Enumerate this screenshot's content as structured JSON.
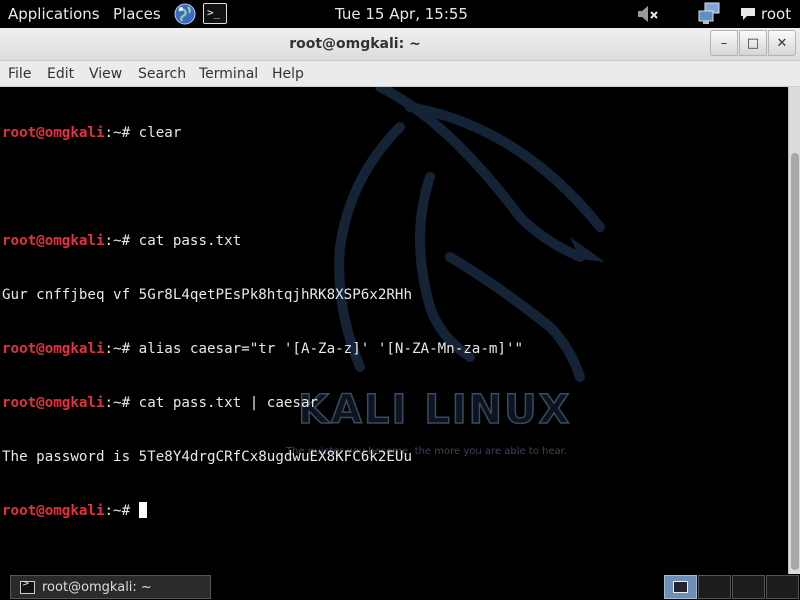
{
  "top_panel": {
    "applications": "Applications",
    "places": "Places",
    "clock": "Tue 15 Apr, 15:55",
    "user": "root",
    "terminal_launcher_glyph": ">_"
  },
  "window": {
    "title": "root@omgkali: ~",
    "minimize_glyph": "–",
    "maximize_glyph": "□",
    "close_glyph": "✕"
  },
  "menubar": {
    "items": [
      "File",
      "Edit",
      "View",
      "Search",
      "Terminal",
      "Help"
    ]
  },
  "terminal": {
    "prompt_user": "root@omgkali",
    "prompt_rest": ":~# ",
    "lines": [
      {
        "type": "prompt",
        "text": "clear"
      },
      {
        "type": "blank",
        "text": ""
      },
      {
        "type": "prompt",
        "text": "cat pass.txt"
      },
      {
        "type": "output",
        "text": "Gur cnffjbeq vf 5Gr8L4qetPEsPk8htqjhRK8XSP6x2RHh"
      },
      {
        "type": "prompt",
        "text": "alias caesar=\"tr '[A-Za-z]' '[N-ZA-Mn-za-m]'\""
      },
      {
        "type": "prompt",
        "text": "cat pass.txt | caesar"
      },
      {
        "type": "output",
        "text": "The password is 5Te8Y4drgCRfCx8ugdwuEX8KFC6k2EUu"
      },
      {
        "type": "prompt",
        "text": ""
      }
    ],
    "background_logo": "KALI LINUX",
    "background_tagline": "The quieter you become, the more you are able to hear."
  },
  "taskbar": {
    "task_label": "root@omgkali: ~"
  },
  "colors": {
    "prompt": "#e3323f",
    "panel": "#000000",
    "active_workspace": "#6d8fb5"
  }
}
